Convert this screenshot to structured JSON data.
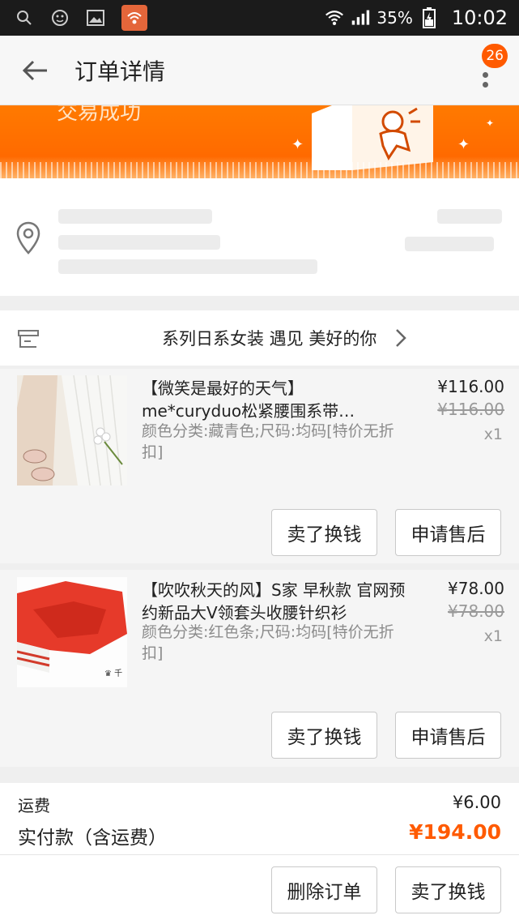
{
  "status_bar": {
    "battery": "35%",
    "time": "10:02"
  },
  "header": {
    "title": "订单详情",
    "badge_count": "26"
  },
  "banner": {
    "status_text": "交易成功"
  },
  "shop": {
    "name": "系列日系女装 遇见 美好的你"
  },
  "items": [
    {
      "title": "【微笑是最好的天气】me*curyduo松紧腰围系带…",
      "sku": "颜色分类:藏青色;尺码:均码[特价无折扣]",
      "price": "¥116.00",
      "original_price": "¥116.00",
      "qty": "x1",
      "button_sell": "卖了换钱",
      "button_aftersale": "申请售后"
    },
    {
      "title": "【吹吹秋天的风】S家 早秋款 官网预约新品大V领套头收腰针织衫",
      "sku": "颜色分类:红色条;尺码:均码[特价无折扣]",
      "price": "¥78.00",
      "original_price": "¥78.00",
      "qty": "x1",
      "button_sell": "卖了换钱",
      "button_aftersale": "申请售后"
    }
  ],
  "totals": {
    "shipping_label": "运费",
    "shipping_value": "¥6.00",
    "paid_label": "实付款（含运费）",
    "paid_value": "¥194.00"
  },
  "footer": {
    "delete_order": "删除订单",
    "sell": "卖了换钱"
  },
  "colors": {
    "accent": "#ff6a00",
    "banner": "#ff7a00"
  }
}
